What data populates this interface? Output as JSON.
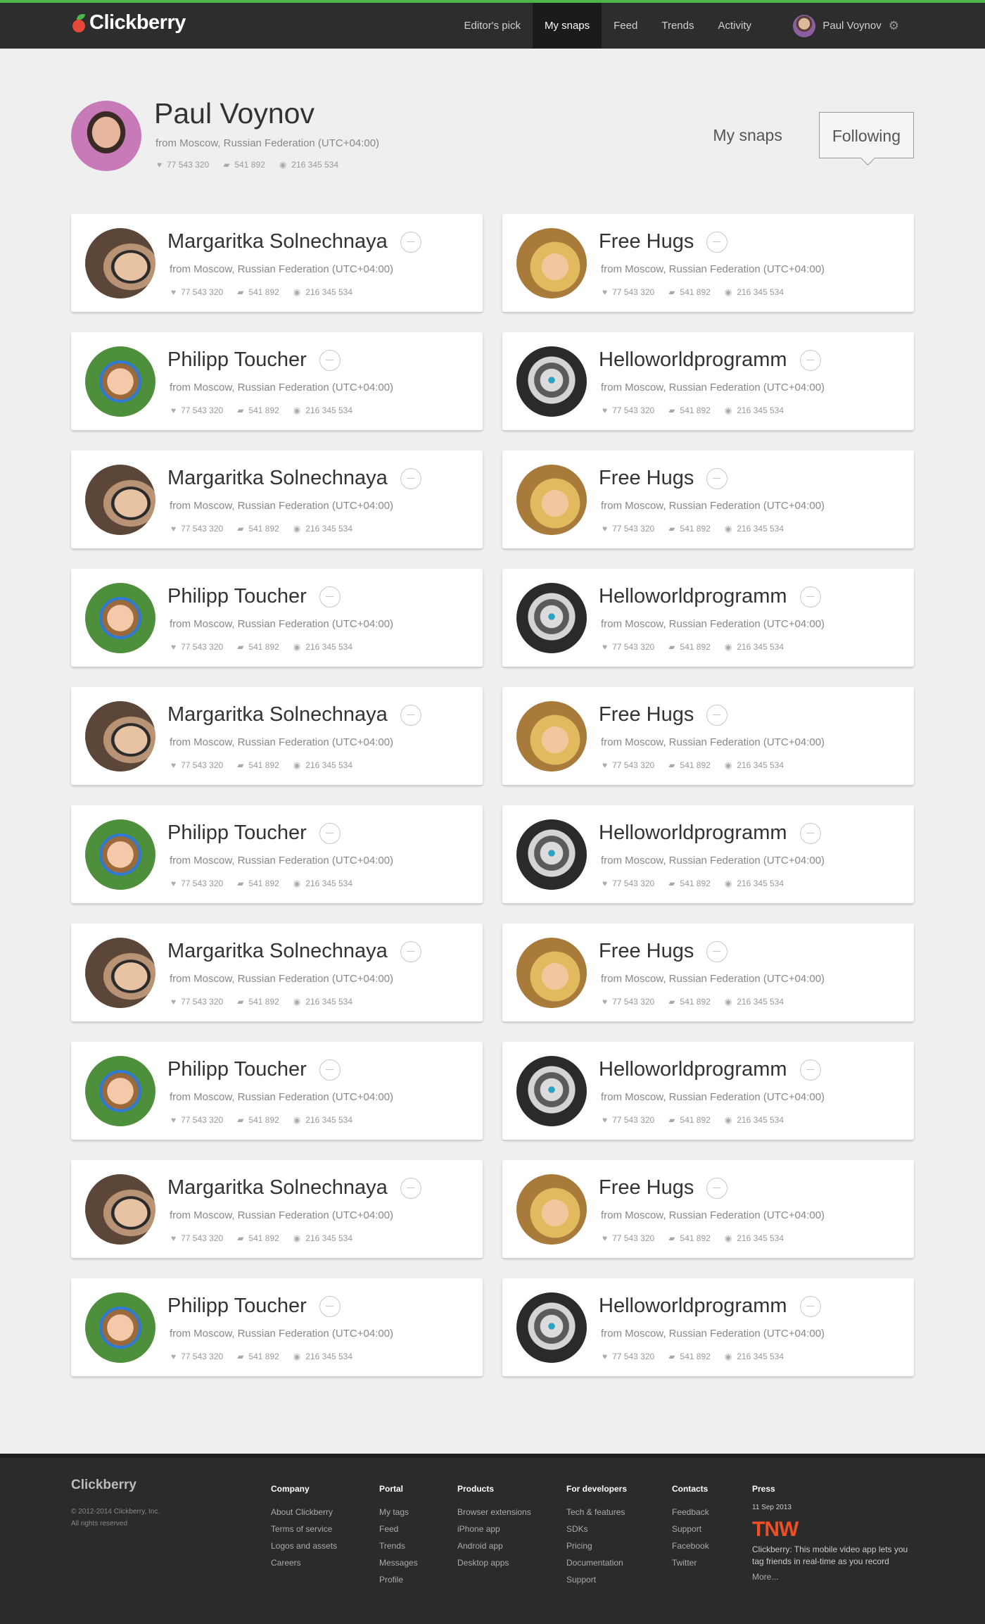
{
  "header": {
    "logo": "Clickberry",
    "nav": [
      {
        "label": "Editor's pick",
        "active": false
      },
      {
        "label": "My snaps",
        "active": true
      },
      {
        "label": "Feed",
        "active": false
      },
      {
        "label": "Trends",
        "active": false
      },
      {
        "label": "Activity",
        "active": false
      }
    ],
    "user_name": "Paul Voynov",
    "accent_color": "#4cb848"
  },
  "profile": {
    "name": "Paul Voynov",
    "location": "from Moscow, Russian Federation (UTC+04:00)",
    "likes": "77 543 320",
    "comments": "541 892",
    "views": "216 345 534"
  },
  "tabs": [
    {
      "label": "My snaps",
      "active": false
    },
    {
      "label": "Following",
      "active": true
    }
  ],
  "following": [
    {
      "name": "Margaritka Solnechnaya",
      "avatar": "margaritka",
      "location": "from Moscow, Russian Federation (UTC+04:00)",
      "likes": "77 543 320",
      "comments": "541 892",
      "views": "216 345 534"
    },
    {
      "name": "Free Hugs",
      "avatar": "hugs",
      "location": "from Moscow, Russian Federation (UTC+04:00)",
      "likes": "77 543 320",
      "comments": "541 892",
      "views": "216 345 534"
    },
    {
      "name": "Philipp Toucher",
      "avatar": "philipp",
      "location": "from Moscow, Russian Federation (UTC+04:00)",
      "likes": "77 543 320",
      "comments": "541 892",
      "views": "216 345 534"
    },
    {
      "name": "Helloworldprogramm",
      "avatar": "hello",
      "location": "from Moscow, Russian Federation (UTC+04:00)",
      "likes": "77 543 320",
      "comments": "541 892",
      "views": "216 345 534"
    },
    {
      "name": "Margaritka Solnechnaya",
      "avatar": "margaritka",
      "location": "from Moscow, Russian Federation (UTC+04:00)",
      "likes": "77 543 320",
      "comments": "541 892",
      "views": "216 345 534"
    },
    {
      "name": "Free Hugs",
      "avatar": "hugs",
      "location": "from Moscow, Russian Federation (UTC+04:00)",
      "likes": "77 543 320",
      "comments": "541 892",
      "views": "216 345 534"
    },
    {
      "name": "Philipp Toucher",
      "avatar": "philipp",
      "location": "from Moscow, Russian Federation (UTC+04:00)",
      "likes": "77 543 320",
      "comments": "541 892",
      "views": "216 345 534"
    },
    {
      "name": "Helloworldprogramm",
      "avatar": "hello",
      "location": "from Moscow, Russian Federation (UTC+04:00)",
      "likes": "77 543 320",
      "comments": "541 892",
      "views": "216 345 534"
    },
    {
      "name": "Margaritka Solnechnaya",
      "avatar": "margaritka",
      "location": "from Moscow, Russian Federation (UTC+04:00)",
      "likes": "77 543 320",
      "comments": "541 892",
      "views": "216 345 534"
    },
    {
      "name": "Free Hugs",
      "avatar": "hugs",
      "location": "from Moscow, Russian Federation (UTC+04:00)",
      "likes": "77 543 320",
      "comments": "541 892",
      "views": "216 345 534"
    },
    {
      "name": "Philipp Toucher",
      "avatar": "philipp",
      "location": "from Moscow, Russian Federation (UTC+04:00)",
      "likes": "77 543 320",
      "comments": "541 892",
      "views": "216 345 534"
    },
    {
      "name": "Helloworldprogramm",
      "avatar": "hello",
      "location": "from Moscow, Russian Federation (UTC+04:00)",
      "likes": "77 543 320",
      "comments": "541 892",
      "views": "216 345 534"
    },
    {
      "name": "Margaritka Solnechnaya",
      "avatar": "margaritka",
      "location": "from Moscow, Russian Federation (UTC+04:00)",
      "likes": "77 543 320",
      "comments": "541 892",
      "views": "216 345 534"
    },
    {
      "name": "Free Hugs",
      "avatar": "hugs",
      "location": "from Moscow, Russian Federation (UTC+04:00)",
      "likes": "77 543 320",
      "comments": "541 892",
      "views": "216 345 534"
    },
    {
      "name": "Philipp Toucher",
      "avatar": "philipp",
      "location": "from Moscow, Russian Federation (UTC+04:00)",
      "likes": "77 543 320",
      "comments": "541 892",
      "views": "216 345 534"
    },
    {
      "name": "Helloworldprogramm",
      "avatar": "hello",
      "location": "from Moscow, Russian Federation (UTC+04:00)",
      "likes": "77 543 320",
      "comments": "541 892",
      "views": "216 345 534"
    },
    {
      "name": "Margaritka Solnechnaya",
      "avatar": "margaritka",
      "location": "from Moscow, Russian Federation (UTC+04:00)",
      "likes": "77 543 320",
      "comments": "541 892",
      "views": "216 345 534"
    },
    {
      "name": "Free Hugs",
      "avatar": "hugs",
      "location": "from Moscow, Russian Federation (UTC+04:00)",
      "likes": "77 543 320",
      "comments": "541 892",
      "views": "216 345 534"
    },
    {
      "name": "Philipp Toucher",
      "avatar": "philipp",
      "location": "from Moscow, Russian Federation (UTC+04:00)",
      "likes": "77 543 320",
      "comments": "541 892",
      "views": "216 345 534"
    },
    {
      "name": "Helloworldprogramm",
      "avatar": "hello",
      "location": "from Moscow, Russian Federation (UTC+04:00)",
      "likes": "77 543 320",
      "comments": "541 892",
      "views": "216 345 534"
    }
  ],
  "footer": {
    "logo": "Clickberry",
    "copyright": "© 2012-2014 Clickberry, Inc.",
    "rights": "All rights reserved",
    "columns": [
      {
        "title": "Company",
        "links": [
          "About Clickberry",
          "Terms of service",
          "Logos and assets",
          "Careers"
        ]
      },
      {
        "title": "Portal",
        "links": [
          "My tags",
          "Feed",
          "Trends",
          "Messages",
          "Profile"
        ]
      },
      {
        "title": "Products",
        "links": [
          "Browser extensions",
          "iPhone app",
          "Android app",
          "Desktop apps"
        ]
      },
      {
        "title": "For developers",
        "links": [
          "Tech & features",
          "SDKs",
          "Pricing",
          "Documentation",
          "Support"
        ]
      },
      {
        "title": "Contacts",
        "links": [
          "Feedback",
          "Support",
          "Facebook",
          "Twitter"
        ]
      }
    ],
    "press": {
      "title": "Press",
      "date": "11 Sep 2013",
      "source": "TNW",
      "text": "Clickberry: This mobile video app lets you tag friends in real-time as you record",
      "more": "More..."
    }
  }
}
